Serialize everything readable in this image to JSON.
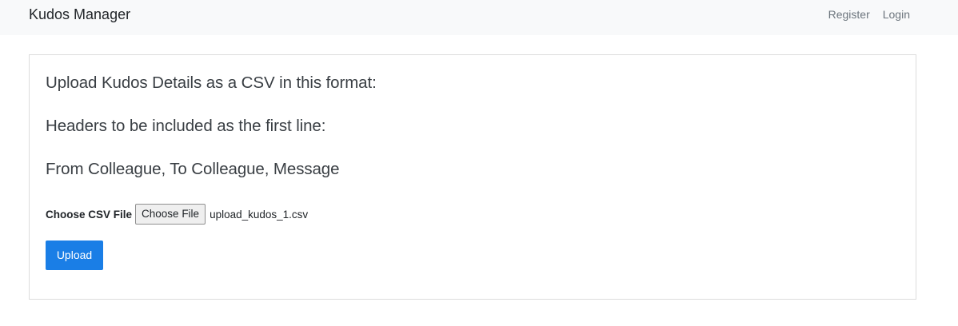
{
  "navbar": {
    "brand": "Kudos Manager",
    "links": [
      {
        "label": "Register"
      },
      {
        "label": "Login"
      }
    ]
  },
  "card": {
    "line1": "Upload Kudos Details as a CSV in this format:",
    "line2": "Headers to be included as the first line:",
    "line3": "From Colleague, To Colleague, Message",
    "file_input": {
      "label": "Choose CSV File",
      "button_label": "Choose File",
      "selected_file": "upload_kudos_1.csv"
    },
    "upload_label": "Upload"
  },
  "colors": {
    "navbar_bg": "#f8f9fa",
    "primary": "#1a7ee6",
    "card_border": "#dcdcdc"
  }
}
